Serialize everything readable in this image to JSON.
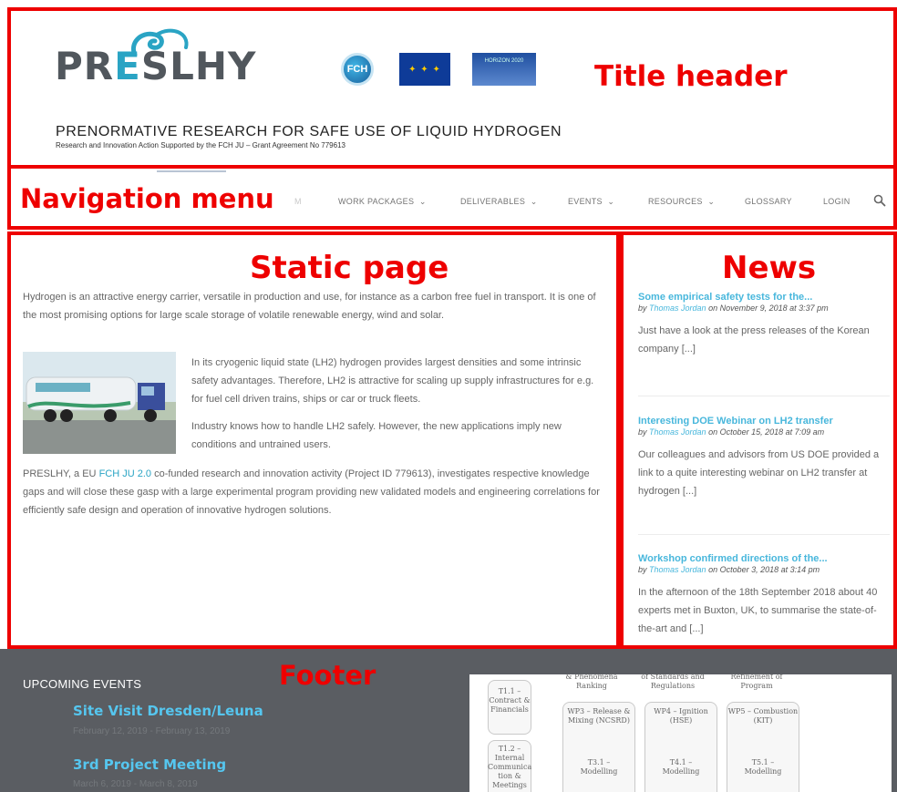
{
  "annotations": {
    "title_header": "Title header",
    "navigation_menu": "Navigation menu",
    "static_page": "Static page",
    "news": "News",
    "footer": "Footer",
    "color": "#ee0000"
  },
  "header": {
    "logo_pre": "PR",
    "logo_mid": "E",
    "logo_post": "SLHY",
    "badge_fch": "FCH",
    "badge_h2020": "HORIZON 2020",
    "title": "PRENORMATIVE RESEARCH FOR SAFE USE OF LIQUID HYDROGEN",
    "subtitle": "Research and Innovation Action Supported by the FCH JU – Grant Agreement No 779613"
  },
  "nav": {
    "partial_item": "M",
    "items": [
      {
        "label": "WORK PACKAGES",
        "has_dropdown": true
      },
      {
        "label": "DELIVERABLES",
        "has_dropdown": true
      },
      {
        "label": "EVENTS",
        "has_dropdown": true
      },
      {
        "label": "RESOURCES",
        "has_dropdown": true
      },
      {
        "label": "GLOSSARY",
        "has_dropdown": false
      },
      {
        "label": "LOGIN",
        "has_dropdown": false
      }
    ],
    "chevron": "⌄",
    "search_icon": "search-icon"
  },
  "static_page": {
    "intro": "Hydrogen is an attractive energy carrier, versatile in production and use, for instance as a carbon free fuel in transport. It is one of the most promising options for large scale storage of volatile renewable energy, wind and solar.",
    "para_lh2": "In its cryogenic liquid state (LH2)  hydrogen provides largest densities and some intrinsic safety advantages. Therefore,  LH2 is attractive for scaling up supply infrastructures for e.g. for fuel cell driven trains, ships or car or truck fleets.",
    "para_industry": "Industry knows how to handle LH2 safely. However, the new applications imply new conditions and untrained users.",
    "para_preslhy_before": "PRESLHY, a EU ",
    "para_preslhy_link": "FCH JU 2.0",
    "para_preslhy_after": " co-funded research and innovation activity (Project ID 779613), investigates respective knowledge gaps and will close these gasp with a large experimental program providing new validated models and engineering correlations for efficiently safe design and operation of innovative hydrogen solutions."
  },
  "news": {
    "by": "by",
    "on": "on",
    "items": [
      {
        "title": "Some empirical safety tests for the...",
        "author": "Thomas Jordan",
        "date": "November 9, 2018 at 3:37 pm",
        "excerpt": "Just have a look at the press releases of the Korean company [...]"
      },
      {
        "title": "Interesting DOE Webinar on LH2 transfer",
        "author": "Thomas Jordan",
        "date": "October 15, 2018 at 7:09 am",
        "excerpt": "Our colleagues and advisors from US DOE provided a link to a quite interesting webinar on LH2 transfer at hydrogen [...]"
      },
      {
        "title": "Workshop confirmed directions of the...",
        "author": "Thomas Jordan",
        "date": "October 3, 2018 at 3:14 pm",
        "excerpt": "In the afternoon of the 18th September 2018 about 40 experts met in Buxton, UK, to summarise the state-of-the-art and [...]"
      }
    ]
  },
  "footer": {
    "heading": "UPCOMING EVENTS",
    "events": [
      {
        "title": "Site Visit Dresden/Leuna",
        "date": "February 12, 2019 - February 13, 2019"
      },
      {
        "title": "3rd Project Meeting",
        "date": "March 6, 2019 - March 8, 2019"
      }
    ],
    "diagram": {
      "top_cells": [
        "& Phenomena Ranking",
        "of Standards and Regulations",
        "Refinement of Program"
      ],
      "t11": "T1.1 – Contract & Financials",
      "t12": "T1.2 – Internal Communica tion & Meetings",
      "wps": [
        {
          "title": "WP3 – Release & Mixing (NCSRD)",
          "task": "T3.1 – Modelling"
        },
        {
          "title": "WP4 – Ignition (HSE)",
          "task": "T4.1 – Modelling"
        },
        {
          "title": "WP5 – Combustion (KIT)",
          "task": "T5.1 – Modelling"
        }
      ]
    }
  }
}
